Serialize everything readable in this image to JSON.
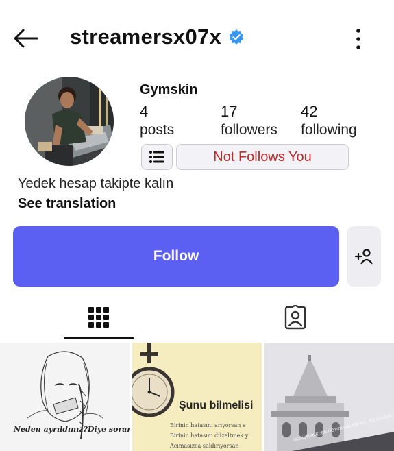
{
  "header": {
    "username": "streamersx07x",
    "back_icon": "arrow-left-icon",
    "verified_icon": "verified-badge-icon",
    "more_icon": "vertical-dots-icon",
    "verified_color": "#3897f0"
  },
  "profile": {
    "display_name": "Gymskin",
    "stats": {
      "posts_count": "4",
      "posts_label": "posts",
      "followers_count": "17",
      "followers_label": "followers",
      "following_count": "42",
      "following_label": "following"
    },
    "not_follows_label": "Not Follows You",
    "not_follows_color": "#c0282a",
    "bio": "Yedek hesap takipte kalın",
    "see_translation": "See translation"
  },
  "actions": {
    "follow_label": "Follow",
    "follow_color": "#5b5ff2",
    "suggest_icon": "add-person-icon"
  },
  "tabs": [
    {
      "name": "grid",
      "icon": "grid-icon",
      "active": true
    },
    {
      "name": "tagged",
      "icon": "tagged-person-icon",
      "active": false
    }
  ],
  "posts": [
    {
      "caption": "Neden ayrıldınız?Diye soranlara"
    },
    {
      "title": "Şunu bilmelisi",
      "lines": [
        "Birinin hatasını arıyorsan e",
        "Birinin hatasını düzeltmek y",
        "Acımasızca saldırıyorsan"
      ]
    },
    {
      "caption": "DEĞİŞTİRMEDEN GÖTÜN GALATA KU... KIZ KULESİ..."
    }
  ]
}
